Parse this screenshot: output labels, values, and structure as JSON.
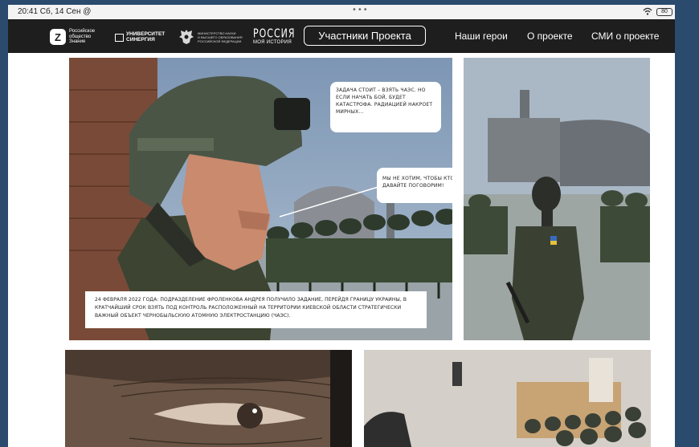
{
  "statusbar": {
    "time": "20:41 Сб, 14 Сен",
    "at_icon": "@",
    "dots": "•••",
    "battery": "80"
  },
  "navbar": {
    "logo1_icon": "Z",
    "logo1_text": "Российское\nобщество\nЗнание",
    "logo2_text": "УНИВЕРСИТЕТ\nСИНЕРГИЯ",
    "logo3_text": "МИНИСТЕРСТВО НАУКИ\nИ ВЫСШЕГО ОБРАЗОВАНИЯ\nРОССИЙСКОЙ ФЕДЕРАЦИИ",
    "logo4_title": "РОССИЯ",
    "logo4_sub": "МОЯ ИСТОРИЯ",
    "project_button": "Участники Проекта",
    "links": [
      "Наши герои",
      "О проекте",
      "СМИ о проекте"
    ]
  },
  "comic": {
    "bubble1": "ЗАДАЧА СТОИТ – ВЗЯТЬ ЧАЭС. НО ЕСЛИ НАЧАТЬ БОЙ, БУДЕТ КАТАСТРОФА. РАДИАЦИЕЙ НАКРОЕТ МИРНЫХ...",
    "bubble2": "МЫ НЕ ХОТИМ, ЧТОБЫ КТО-ТО ПОСТРАДАЛ! ДАВАЙТЕ ПОГОВОРИМ!",
    "caption": "24 ФЕВРАЛЯ 2022 ГОДА: ПОДРАЗДЕЛЕНИЕ ФРОЛЕНКОВА АНДРЕЯ ПОЛУЧИЛО ЗАДАНИЕ, ПЕРЕЙДЯ ГРАНИЦУ УКРАИНЫ, В КРАТЧАЙШИЙ СРОК ВЗЯТЬ ПОД КОНТРОЛЬ РАСПОЛОЖЕННЫЙ НА ТЕРРИТОРИИ КИЕВСКОЙ ОБЛАСТИ СТРАТЕГИЧЕСКИ ВАЖНЫЙ ОБЪЕКТ ЧЕРНОБЫЛЬСКУЮ АТОМНУЮ ЭЛЕКТРОСТАНЦИЮ (ЧАЭС)."
  }
}
